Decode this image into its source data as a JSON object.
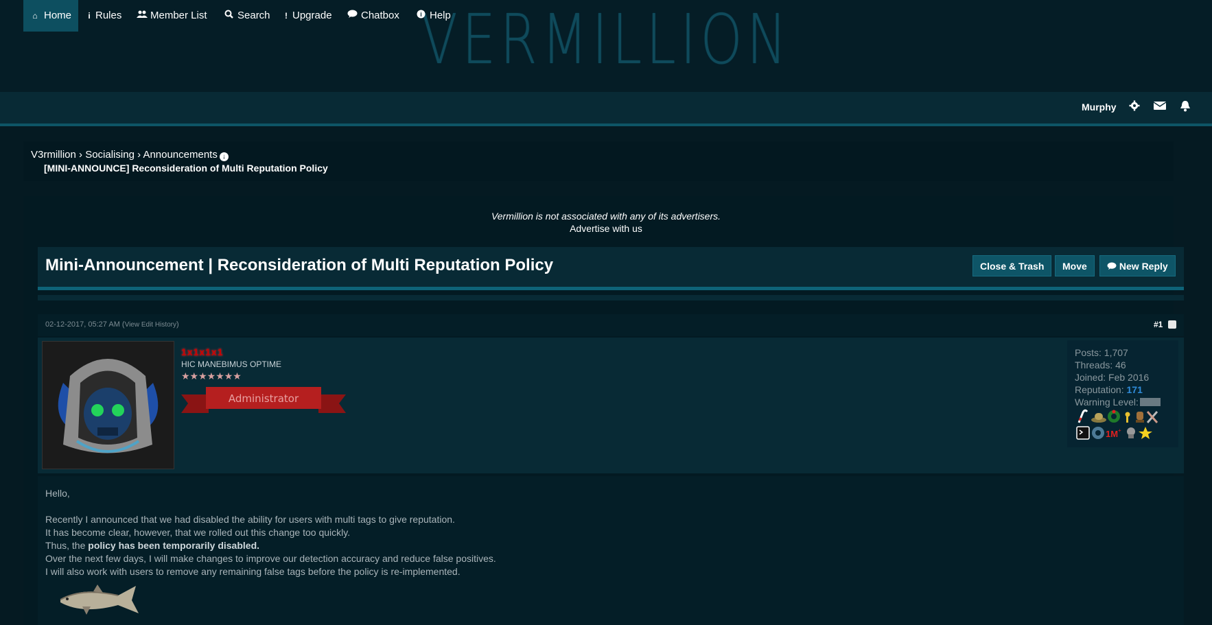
{
  "header": {
    "logo_text": "VERMILLION"
  },
  "nav": {
    "items": [
      {
        "label": "Home",
        "icon": "home-icon"
      },
      {
        "label": "Rules",
        "icon": "info-icon"
      },
      {
        "label": "Member List",
        "icon": "users-icon"
      },
      {
        "label": "Search",
        "icon": "search-icon"
      },
      {
        "label": "Upgrade",
        "icon": "exclamation-icon"
      },
      {
        "label": "Chatbox",
        "icon": "comment-icon"
      },
      {
        "label": "Help",
        "icon": "help-circle-icon"
      }
    ],
    "user": "Murphy"
  },
  "breadcrumb": {
    "items": [
      "V3rmillion",
      "Socialising",
      "Announcements"
    ],
    "separator": "›",
    "current": "[MINI-ANNOUNCE] Reconsideration of Multi Reputation Policy"
  },
  "ads": {
    "note": "Vermillion is not associated with any of its advertisers.",
    "link": "Advertise with us"
  },
  "thread": {
    "title": "Mini-Announcement |  Reconsideration of Multi Reputation Policy",
    "buttons": {
      "close_trash": "Close & Trash",
      "move": "Move",
      "new_reply": "New Reply"
    }
  },
  "post": {
    "date": "02-12-2017, 05:27 AM",
    "edit_history": "View Edit History",
    "number": "#1",
    "author": {
      "name": "1x1x1x1",
      "title": "HIC MANEBIMUS OPTIME",
      "stars": "★★★★★★★",
      "group": "Administrator"
    },
    "stats": {
      "posts_label": "Posts:",
      "posts": "1,707",
      "threads_label": "Threads:",
      "threads": "46",
      "joined_label": "Joined:",
      "joined": "Feb 2016",
      "reputation_label": "Reputation:",
      "reputation": "171",
      "warning_label": "Warning Level:"
    },
    "body": {
      "greeting": "Hello,",
      "line1": "Recently I announced that we had disabled the ability for users with multi tags to give reputation.",
      "line2": "It has become clear, however, that we rolled out this change too quickly.",
      "line3_prefix": "Thus, the ",
      "line3_bold": "policy has been temporarily disabled.",
      "line4": "Over the next few days, I will make changes to improve our detection accuracy and reduce false positives.",
      "line5": "I will also work with users to remove any remaining false tags before the policy is re-implemented."
    }
  },
  "colors": {
    "background": "#051a22",
    "nav_active": "#0d4f60",
    "accent": "#0e6378",
    "username": "#cc0000",
    "reputation": "#2f8bd8"
  }
}
